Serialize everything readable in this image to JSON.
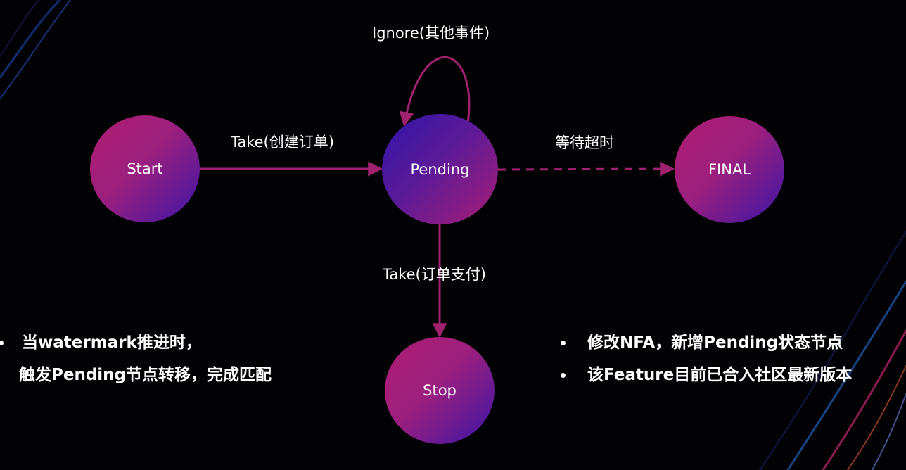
{
  "nodes": {
    "start": "Start",
    "pending": "Pending",
    "final": "FINAL",
    "stop": "Stop"
  },
  "edges": {
    "ignore": "Ignore(其他事件)",
    "take_create": "Take(创建订单)",
    "wait_timeout": "等待超时",
    "take_pay": "Take(订单支付)"
  },
  "notes_left": [
    "当watermark推进时，",
    "触发Pending节点转移，完成匹配"
  ],
  "notes_right": [
    "修改NFA，新增Pending状态节点",
    "该Feature目前已合入社区最新版本"
  ],
  "colors": {
    "background": "#020104",
    "edge": "#a0216f",
    "node_magenta": "#b01e72",
    "node_violet": "#3b15a6"
  }
}
